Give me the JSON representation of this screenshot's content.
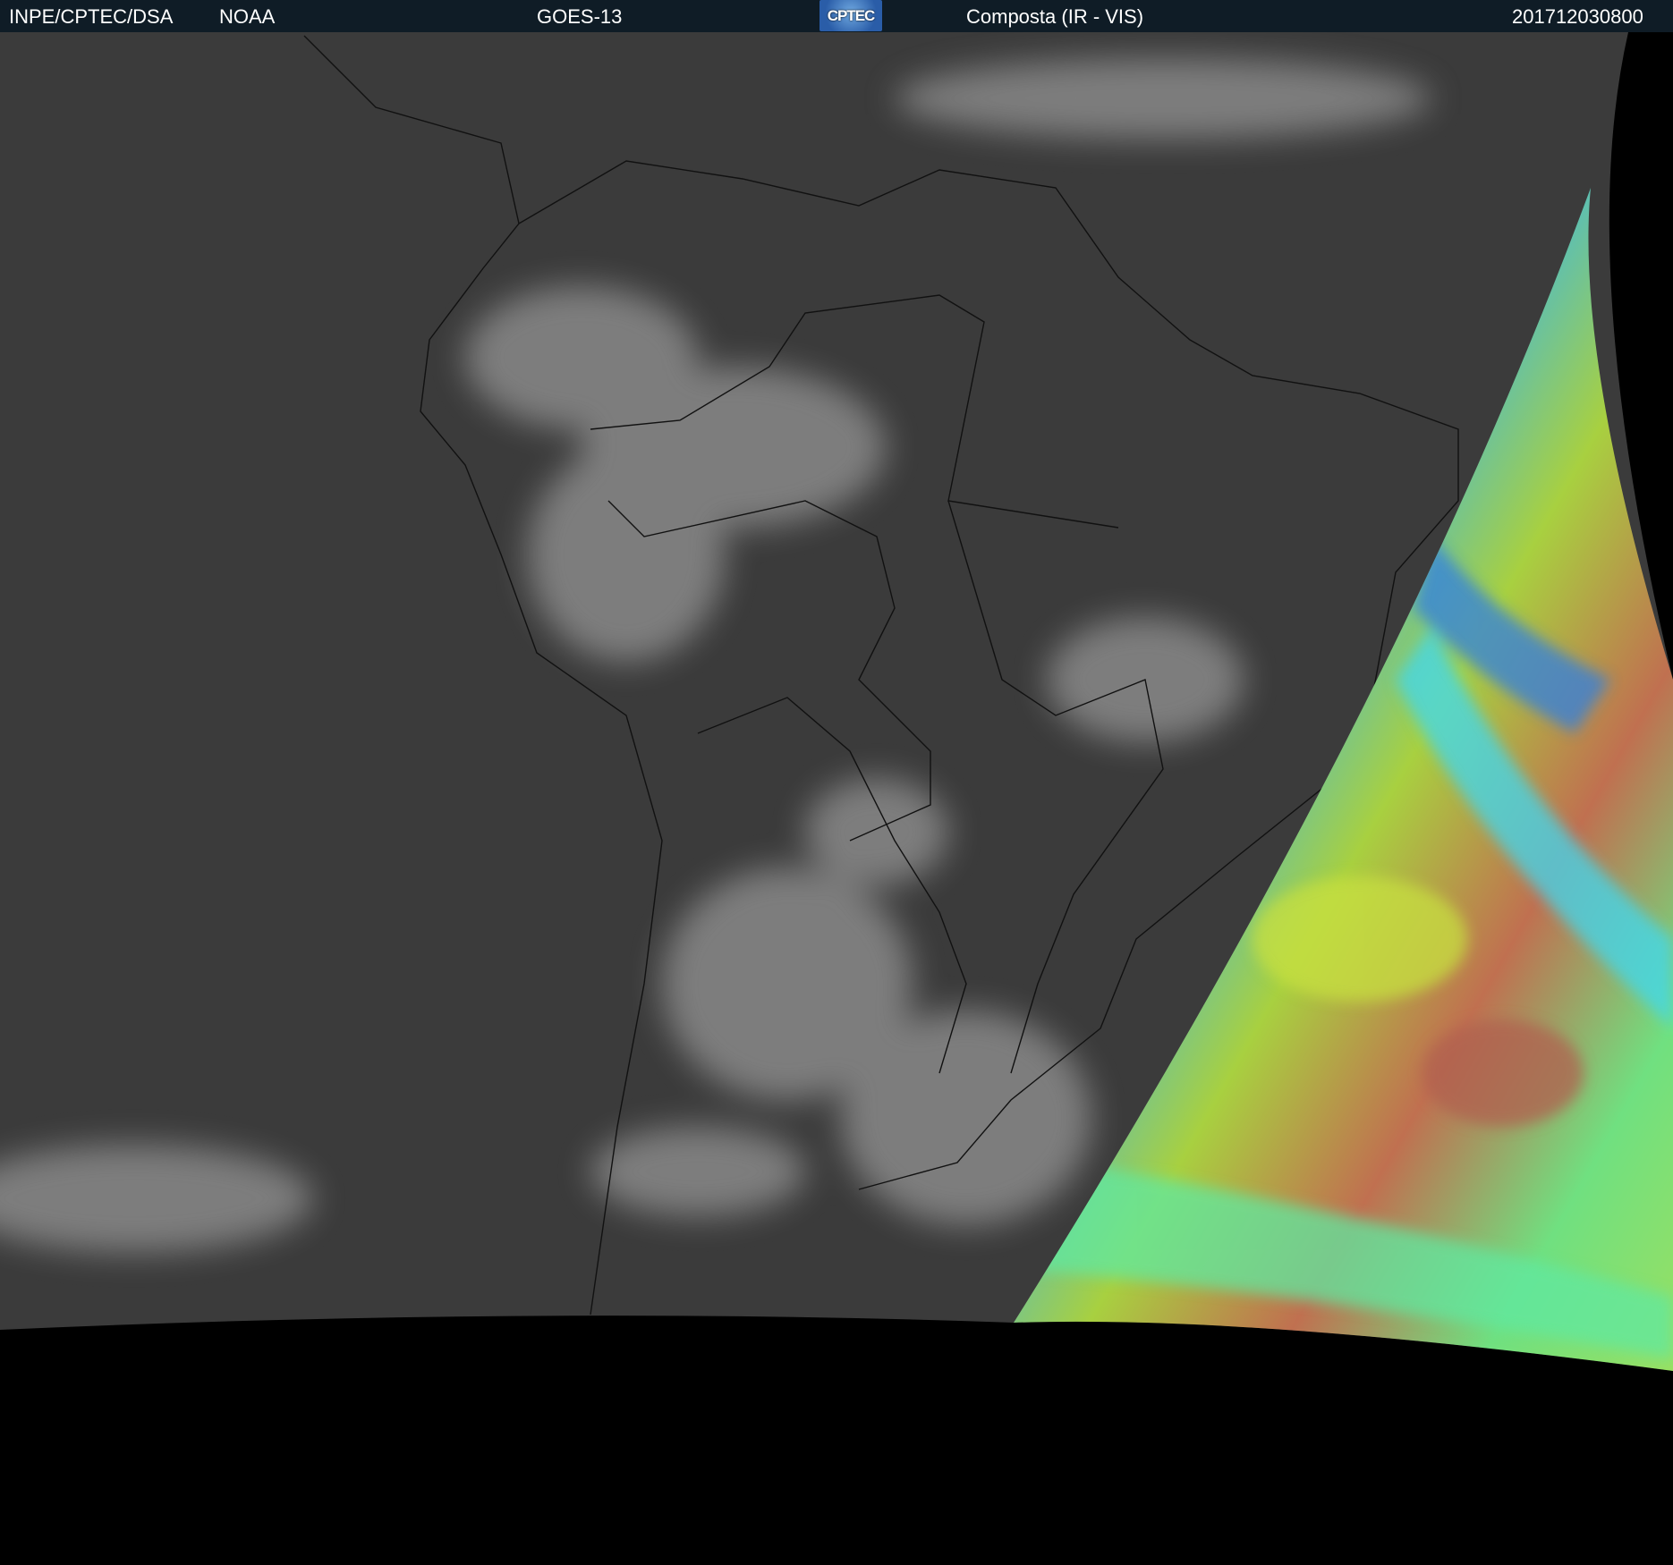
{
  "header": {
    "agency": "INPE/CPTEC/DSA",
    "source": "NOAA",
    "satellite": "GOES-13",
    "logo_text": "CPTEC",
    "product": "Composta (IR - VIS)",
    "timestamp": "201712030800"
  },
  "colors": {
    "header_bg": "#0f1c26",
    "ir_base": "#3b3b3b",
    "background": "#000000"
  }
}
